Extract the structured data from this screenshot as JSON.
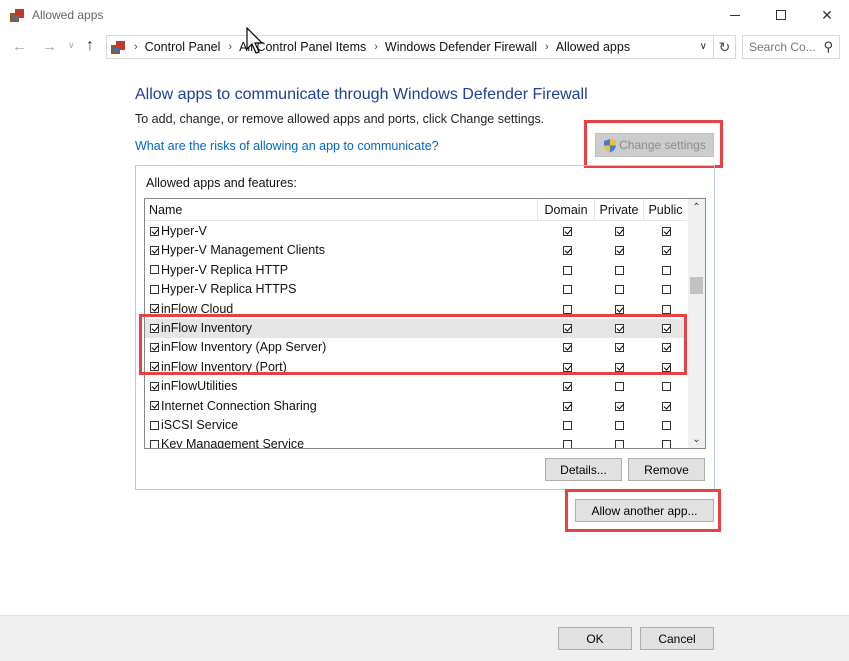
{
  "window": {
    "title": "Allowed apps",
    "minimize_icon": "minimize-icon",
    "maximize_icon": "maximize-icon",
    "close_glyph": "✕"
  },
  "nav": {
    "back_glyph": "←",
    "forward_glyph": "→",
    "recent_glyph": "∨",
    "up_glyph": "↑",
    "breadcrumbs": [
      "Control Panel",
      "All Control Panel Items",
      "Windows Defender Firewall",
      "Allowed apps"
    ],
    "separator": "›",
    "dropdown_glyph": "∨",
    "refresh_glyph": "↻",
    "search_placeholder": "Search Co...",
    "search_glyph": "⚲"
  },
  "content": {
    "heading": "Allow apps to communicate through Windows Defender Firewall",
    "subtext": "To add, change, or remove allowed apps and ports, click Change settings.",
    "risk_link": "What are the risks of allowing an app to communicate?",
    "change_settings_label": "Change settings",
    "group_label": "Allowed apps and features:"
  },
  "table": {
    "columns": [
      "Name",
      "Domain",
      "Private",
      "Public"
    ],
    "rows": [
      {
        "name": "Hyper-V",
        "enabled": true,
        "domain": true,
        "private": true,
        "public": true
      },
      {
        "name": "Hyper-V Management Clients",
        "enabled": true,
        "domain": true,
        "private": true,
        "public": true
      },
      {
        "name": "Hyper-V Replica HTTP",
        "enabled": false,
        "domain": false,
        "private": false,
        "public": false
      },
      {
        "name": "Hyper-V Replica HTTPS",
        "enabled": false,
        "domain": false,
        "private": false,
        "public": false
      },
      {
        "name": "inFlow Cloud",
        "enabled": true,
        "domain": false,
        "private": true,
        "public": false
      },
      {
        "name": "inFlow Inventory",
        "enabled": true,
        "domain": true,
        "private": true,
        "public": true,
        "selected": true
      },
      {
        "name": "inFlow Inventory (App Server)",
        "enabled": true,
        "domain": true,
        "private": true,
        "public": true
      },
      {
        "name": "inFlow Inventory (Port)",
        "enabled": true,
        "domain": true,
        "private": true,
        "public": true
      },
      {
        "name": "inFlowUtilities",
        "enabled": true,
        "domain": true,
        "private": false,
        "public": false
      },
      {
        "name": "Internet Connection Sharing",
        "enabled": true,
        "domain": true,
        "private": true,
        "public": true
      },
      {
        "name": "iSCSI Service",
        "enabled": false,
        "domain": false,
        "private": false,
        "public": false
      },
      {
        "name": "Key Management Service",
        "enabled": false,
        "domain": false,
        "private": false,
        "public": false
      }
    ],
    "scroll_up_glyph": "⌃",
    "scroll_down_glyph": "⌄"
  },
  "buttons": {
    "details": "Details...",
    "remove": "Remove",
    "allow_another": "Allow another app...",
    "ok": "OK",
    "cancel": "Cancel"
  },
  "colors": {
    "highlight": "#e84141",
    "heading": "#1f3f99",
    "link": "#0066cc"
  }
}
